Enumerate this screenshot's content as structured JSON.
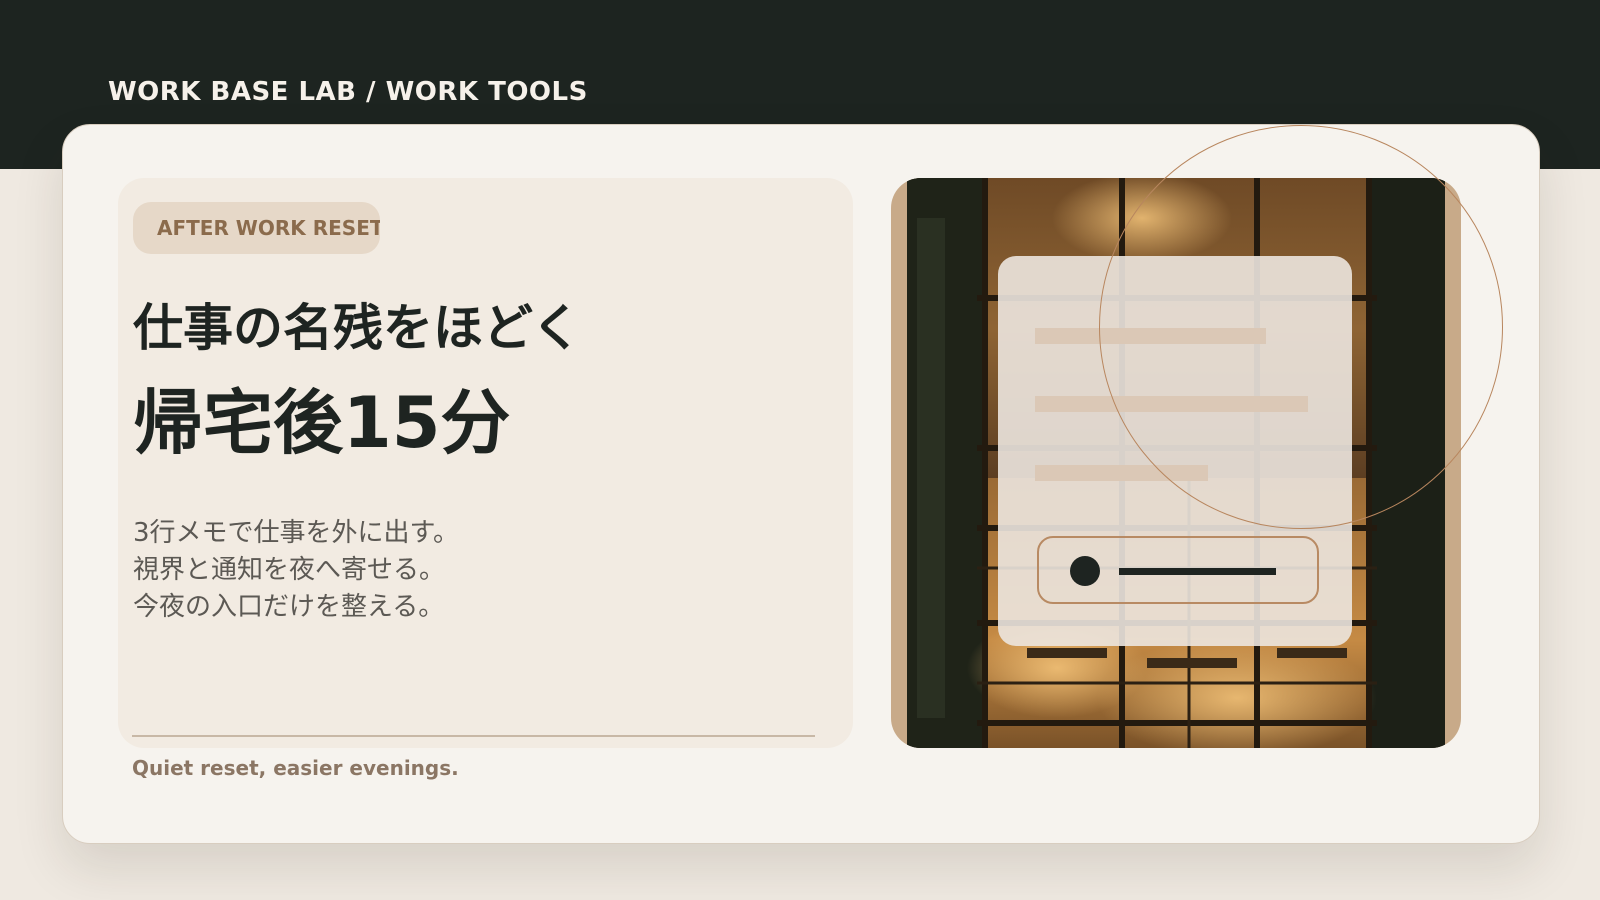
{
  "brand": {
    "title": "WORK BASE LAB / WORK TOOLS"
  },
  "hero": {
    "badge": "AFTER WORK RESET",
    "headline_line1": "仕事の名残をほどく",
    "headline_line2": "帰宅後15分",
    "body_lines": [
      "3行メモで仕事を外に出す。",
      "視界と通知を夜へ寄せる。",
      "今夜の入口だけを整える。"
    ],
    "footer_note": "Quiet reset, easier evenings."
  },
  "visual": {
    "photo_subject": "cafe-interior-night-photo",
    "overlay_card_icon": "form-placeholder-icon",
    "toggle_icon": "toggle-dot-icon"
  },
  "colors": {
    "dark_band": "#1d2420",
    "page_background": "#efe9e1",
    "card_background": "#f6f3ee",
    "panel_background": "#f2ebe2",
    "badge_background": "#e6d8c8",
    "badge_text": "#8b6b4c",
    "heading_text": "#1e2421",
    "body_text": "#5c5954",
    "accent_copper": "#b8865e",
    "image_frame": "#c8aa89"
  }
}
